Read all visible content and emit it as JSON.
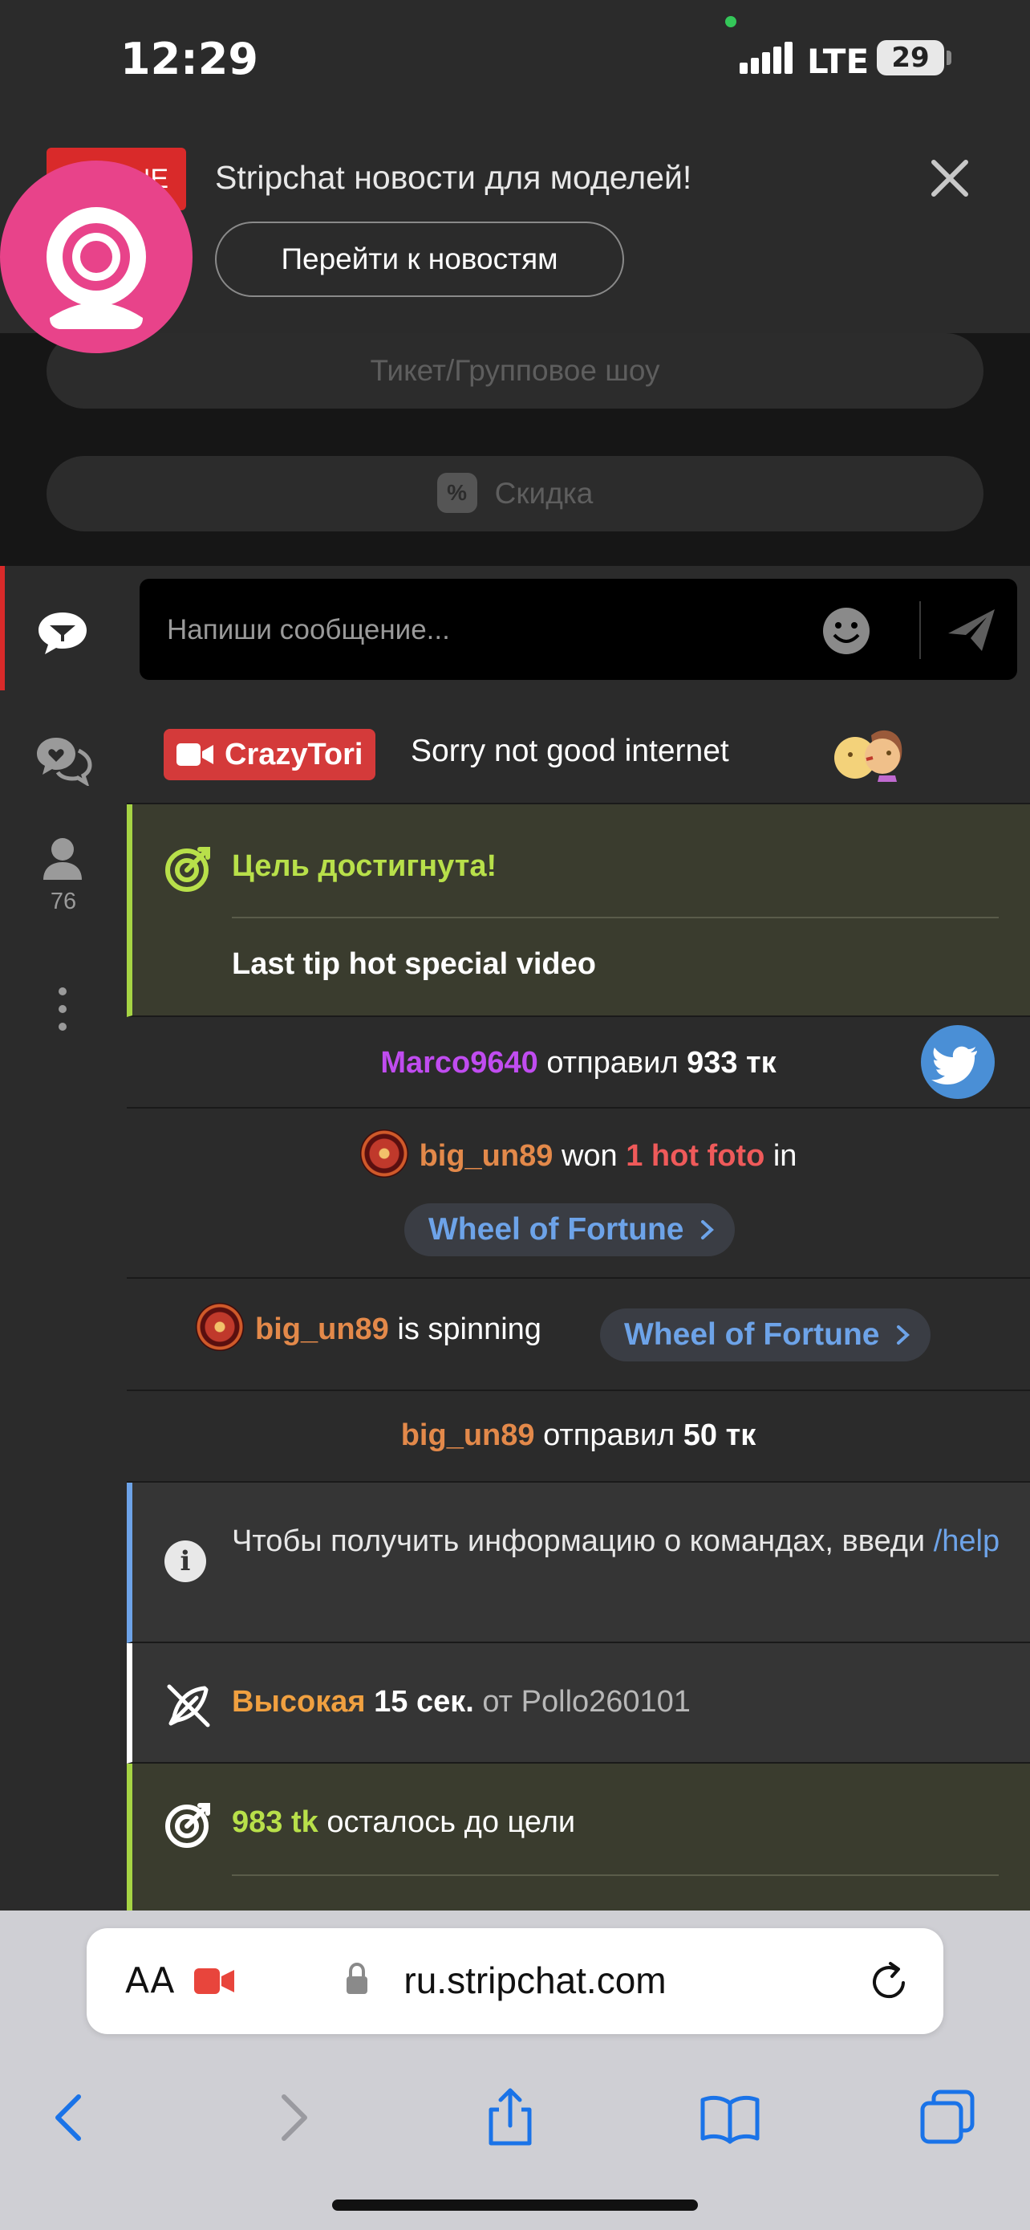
{
  "status_bar": {
    "time": "12:29",
    "network": "LTE",
    "battery": "29"
  },
  "news_banner": {
    "badge_text": "NE",
    "title": "Stripchat новости для моделей!",
    "button": "Перейти к новостям"
  },
  "options": {
    "ticket": "Тикет/Групповое шоу",
    "discount": "Скидка",
    "discount_icon": "%"
  },
  "sidebar": {
    "users_count": "76"
  },
  "chat": {
    "input_placeholder": "Напиши сообщение...",
    "messages": {
      "model_msg": {
        "user": "CrazyTori",
        "text": "Sorry not good internet"
      },
      "goal_reached": {
        "title": "Цель достигнута!",
        "description": "Last tip hot special video"
      },
      "tip1": {
        "user": "Marco9640",
        "action": "отправил",
        "amount": "933 тк"
      },
      "won": {
        "user": "big_un89",
        "action": "won",
        "prize": "1 hot foto",
        "prep": "in",
        "game": "Wheel of Fortune"
      },
      "spin": {
        "user": "big_un89",
        "action": "is spinning",
        "game": "Wheel of Fortune"
      },
      "tip2": {
        "user": "big_un89",
        "action": "отправил",
        "amount": "50 тк"
      },
      "info": {
        "text": "Чтобы получить информацию о командах, введи",
        "command": "/help"
      },
      "priority": {
        "level": "Высокая",
        "duration": "15 сек.",
        "from_label": "от",
        "user": "Pollo260101"
      },
      "goal_left": {
        "amount": "983 tk",
        "text": "осталось до цели"
      }
    }
  },
  "browser": {
    "aa": "AA",
    "url": "ru.stripchat.com"
  },
  "colors": {
    "accent_red": "#d92a2a",
    "goal_green": "#a6d444",
    "link_blue": "#6da3e8",
    "user_purple": "#c04cf0",
    "user_orange": "#e3894a",
    "logo_pink": "#e8438a"
  }
}
